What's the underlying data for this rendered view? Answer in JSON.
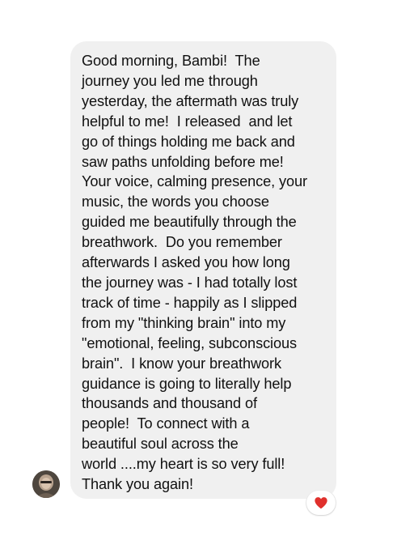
{
  "message": {
    "lines": [
      "Good morning, Bambi!  The",
      "journey you led me through",
      "yesterday, the aftermath was truly",
      "helpful to me!  I released  and let",
      "go of things holding me back and",
      "saw paths unfolding before me!",
      "Your voice, calming presence, your",
      "music, the words you choose",
      "guided me beautifully through the",
      "breathwork.  Do you remember",
      "afterwards I asked you how long",
      "the journey was - I had totally lost",
      "track of time - happily as I slipped",
      "from my \"thinking brain\" into my",
      "\"emotional, feeling, subconscious",
      "brain\".  I know your breathwork",
      "guidance is going to literally help",
      "thousands and thousand of",
      "people!  To connect with a",
      "beautiful soul across the",
      "world ....my heart is so very full!",
      "Thank you again!"
    ],
    "bubble_color": "#f0f0f0",
    "text_color": "#111111"
  },
  "sender": {
    "avatar_icon": "profile-photo"
  },
  "reaction": {
    "icon": "red-heart-icon",
    "color": "#e0302c"
  }
}
